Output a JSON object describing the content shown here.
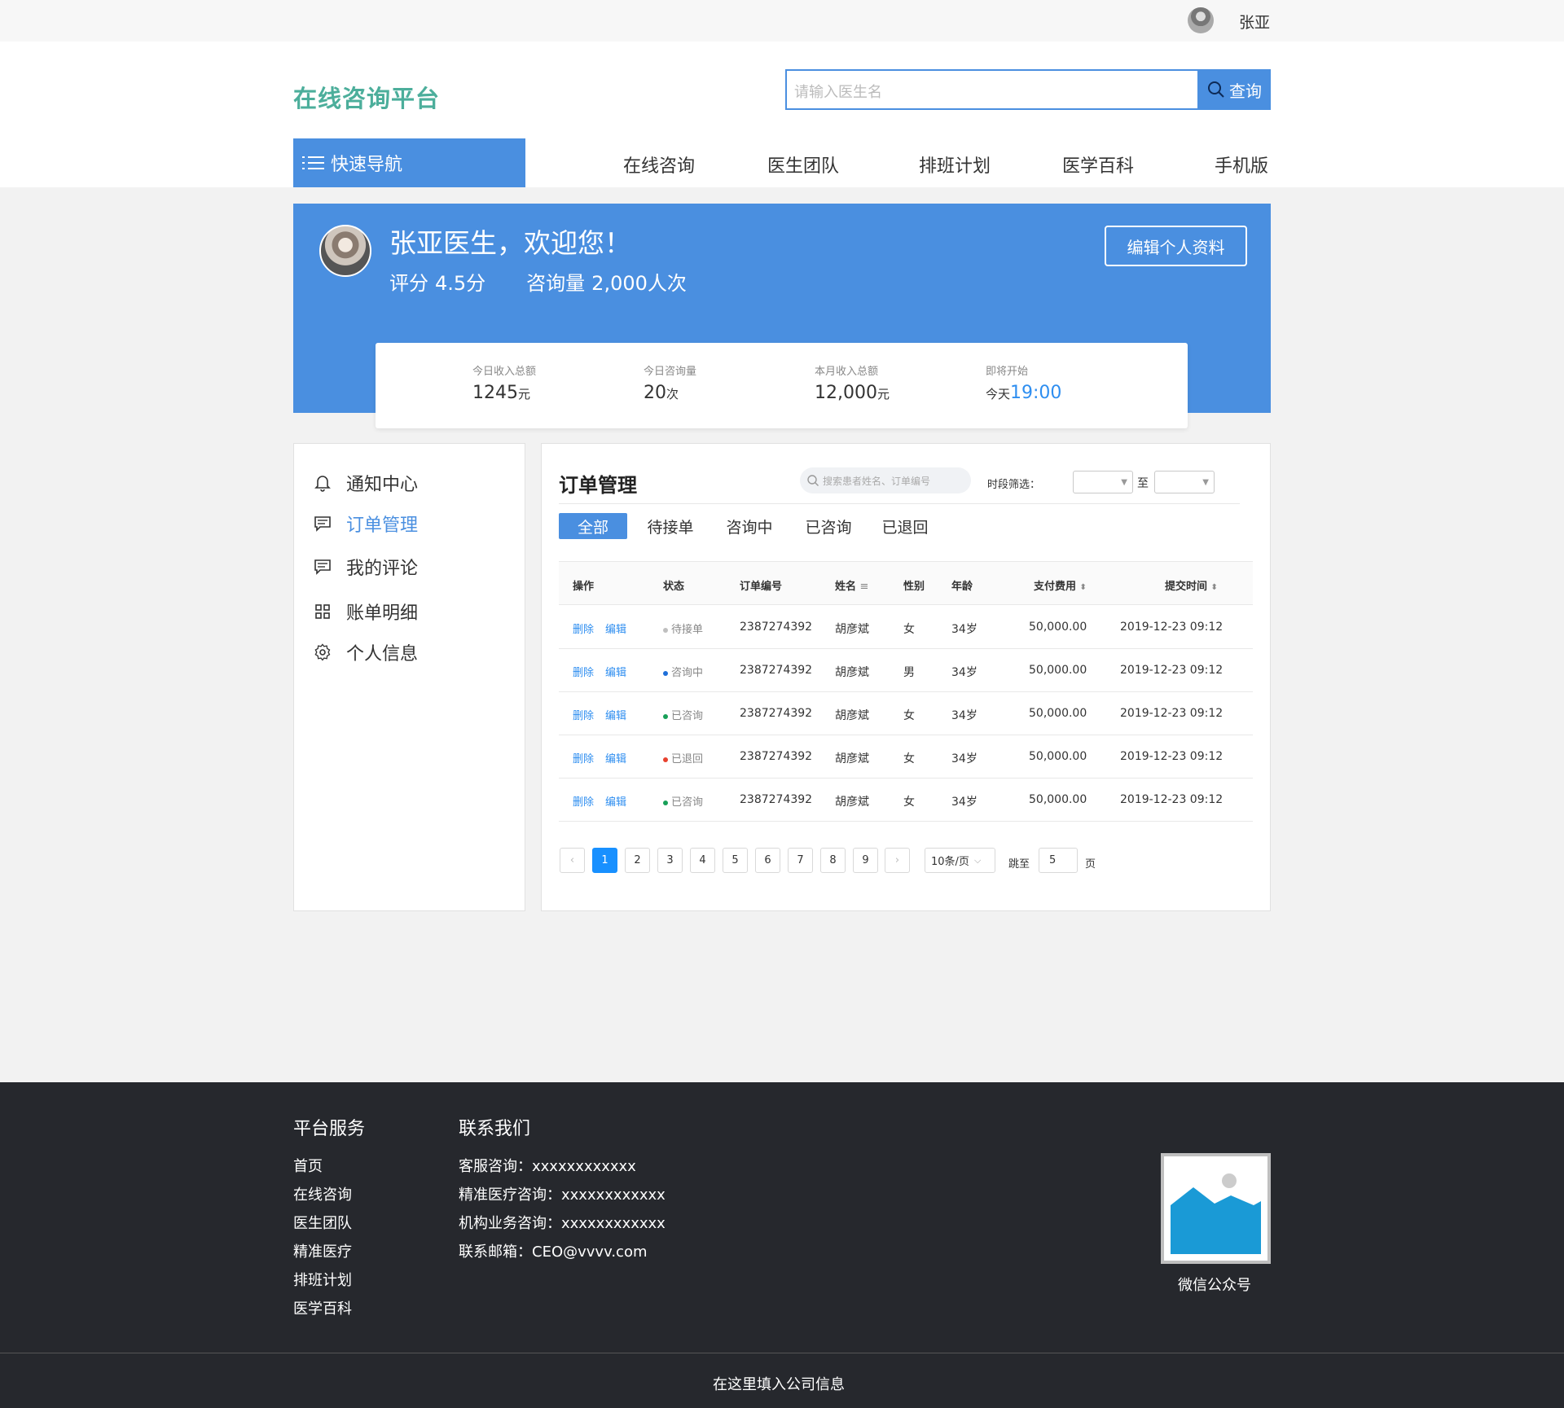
{
  "topbar": {
    "username": "张亚"
  },
  "header": {
    "brand": "在线咨询平台",
    "search_placeholder": "请输入医生名",
    "search_button": "查询",
    "quick_nav": "快速导航",
    "nav": [
      "在线咨询",
      "医生团队",
      "排班计划",
      "医学百科",
      "手机版"
    ]
  },
  "banner": {
    "welcome": "张亚医生，欢迎您！",
    "rating_label": "评分",
    "rating_value": "4.5分",
    "consult_label": "咨询量",
    "consult_value": "2,000人次",
    "edit_button": "编辑个人资料",
    "stats": [
      {
        "label": "今日收入总额",
        "value": "1245",
        "unit": "元"
      },
      {
        "label": "今日咨询量",
        "value": "20",
        "unit": "次"
      },
      {
        "label": "本月收入总额",
        "value": "12,000",
        "unit": "元"
      },
      {
        "label": "即将开始",
        "prefix": "今天",
        "value": "19:00"
      }
    ]
  },
  "sidebar": {
    "items": [
      {
        "label": "通知中心",
        "icon": "bell-icon"
      },
      {
        "label": "订单管理",
        "icon": "message-icon",
        "active": true
      },
      {
        "label": "我的评论",
        "icon": "comment-icon"
      },
      {
        "label": "账单明细",
        "icon": "grid-icon"
      },
      {
        "label": "个人信息",
        "icon": "gear-icon"
      }
    ]
  },
  "orders": {
    "title": "订单管理",
    "search_placeholder": "搜索患者姓名、订单编号",
    "period_label": "时段筛选：",
    "period_sep": "至",
    "tabs": [
      "全部",
      "待接单",
      "咨询中",
      "已咨询",
      "已退回"
    ],
    "active_tab": "全部",
    "columns": [
      "操作",
      "状态",
      "订单编号",
      "姓名",
      "性别",
      "年龄",
      "支付费用",
      "提交时间"
    ],
    "actions": {
      "delete": "删除",
      "edit": "编辑"
    },
    "rows": [
      {
        "status": "待接单",
        "status_color": "#bfbfbf",
        "order_no": "2387274392",
        "name": "胡彦斌",
        "gender": "女",
        "age": "34岁",
        "fee": "50,000.00",
        "time": "2019-12-23  09:12"
      },
      {
        "status": "咨询中",
        "status_color": "#1e6fd9",
        "order_no": "2387274392",
        "name": "胡彦斌",
        "gender": "男",
        "age": "34岁",
        "fee": "50,000.00",
        "time": "2019-12-23  09:12"
      },
      {
        "status": "已咨询",
        "status_color": "#18a058",
        "order_no": "2387274392",
        "name": "胡彦斌",
        "gender": "女",
        "age": "34岁",
        "fee": "50,000.00",
        "time": "2019-12-23  09:12"
      },
      {
        "status": "已退回",
        "status_color": "#e8412e",
        "order_no": "2387274392",
        "name": "胡彦斌",
        "gender": "女",
        "age": "34岁",
        "fee": "50,000.00",
        "time": "2019-12-23  09:12"
      },
      {
        "status": "已咨询",
        "status_color": "#18a058",
        "order_no": "2387274392",
        "name": "胡彦斌",
        "gender": "女",
        "age": "34岁",
        "fee": "50,000.00",
        "time": "2019-12-23  09:12"
      }
    ],
    "pagination": {
      "pages": [
        "1",
        "2",
        "3",
        "4",
        "5",
        "6",
        "7",
        "8",
        "9"
      ],
      "current": "1",
      "page_size": "10条/页",
      "jump_label": "跳至",
      "jump_value": "5",
      "page_suffix": "页"
    }
  },
  "footer": {
    "services_title": "平台服务",
    "services": [
      "首页",
      "在线咨询",
      "医生团队",
      "精准医疗",
      "排班计划",
      "医学百科"
    ],
    "contact_title": "联系我们",
    "contact": [
      "客服咨询：xxxxxxxxxxxx",
      "精准医疗咨询：xxxxxxxxxxxx",
      "机构业务咨询：xxxxxxxxxxxx",
      "联系邮箱：CEO@vvvv.com"
    ],
    "qr_label": "微信公众号",
    "copyright": "在这里填入公司信息"
  },
  "colors": {
    "primary": "#4a8fe0",
    "brand": "#4cae9b",
    "link": "#2e8ef0",
    "footer_bg": "#26282d"
  }
}
